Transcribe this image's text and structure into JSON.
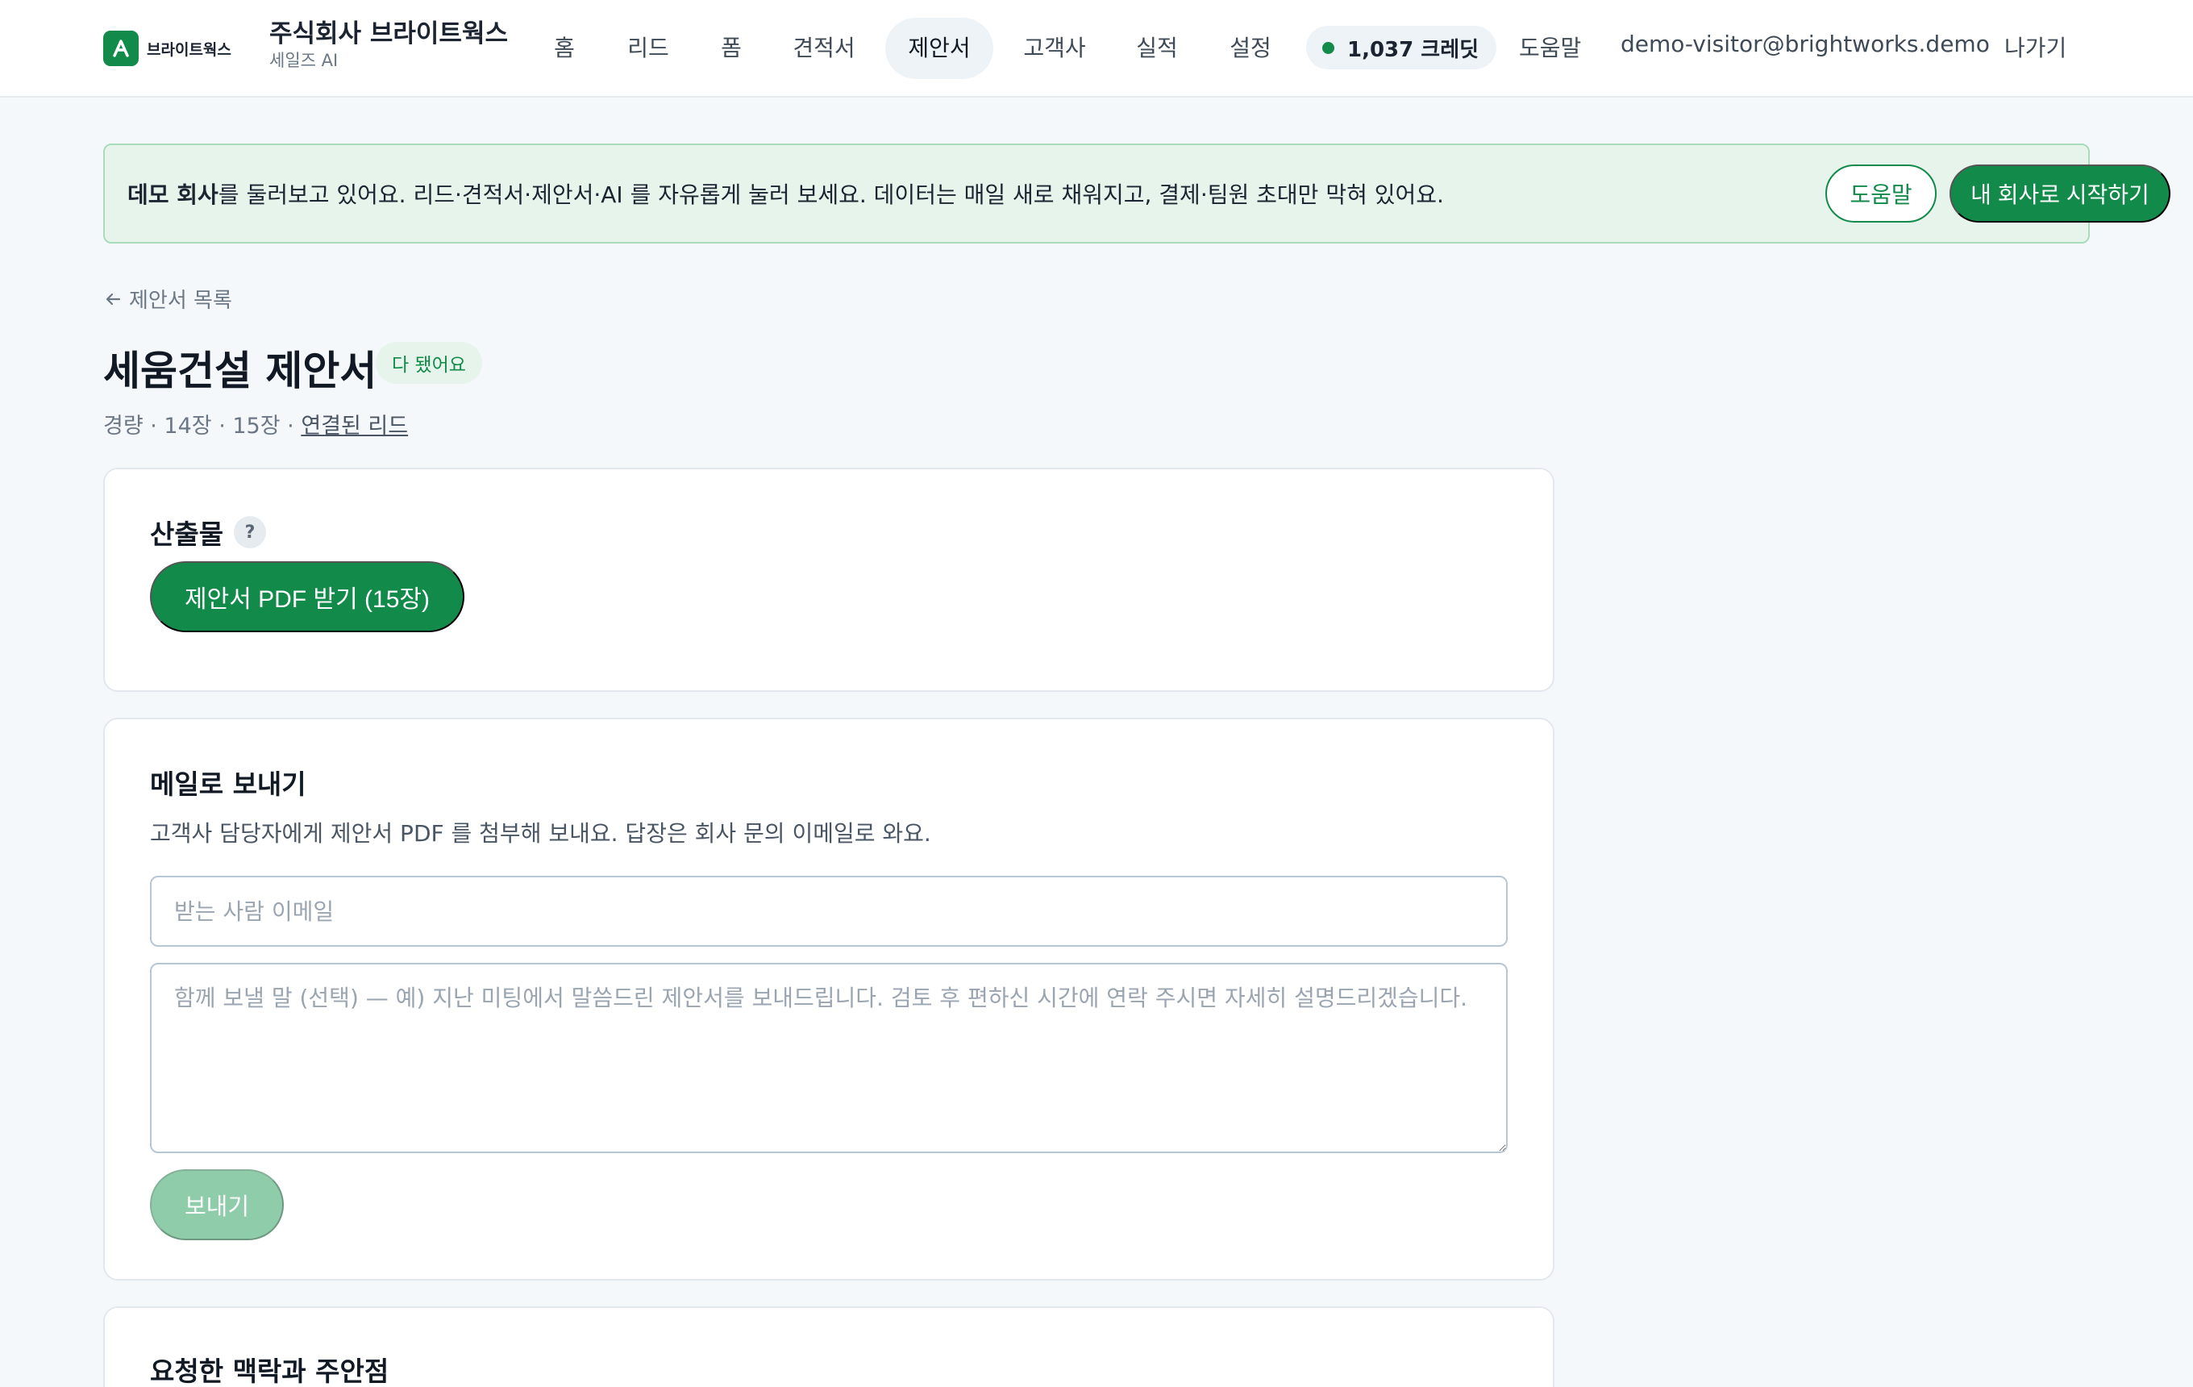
{
  "brand": {
    "logo_text": "브라이트웍스",
    "company_name": "주식회사 브라이트웍스",
    "company_sub": "세일즈 AI"
  },
  "nav": {
    "items": [
      {
        "label": "홈"
      },
      {
        "label": "리드"
      },
      {
        "label": "폼"
      },
      {
        "label": "견적서"
      },
      {
        "label": "제안서",
        "active": true
      },
      {
        "label": "고객사"
      },
      {
        "label": "실적"
      },
      {
        "label": "설정"
      }
    ],
    "credits": "1,037 크레딧",
    "help": "도움말",
    "user_email": "demo-visitor@brightworks.demo",
    "logout": "나가기"
  },
  "banner": {
    "bold": "데모 회사",
    "text": "를 둘러보고 있어요. 리드·견적서·제안서·AI 를 자유롭게 눌러 보세요. 데이터는 매일 새로 채워지고, 결제·팀원 초대만 막혀 있어요.",
    "help_button": "도움말",
    "start_button": "내 회사로 시작하기"
  },
  "header": {
    "back_link": "제안서 목록",
    "title": "세움건설 제안서",
    "status": "다 됐어요",
    "meta": "경량 · 14장 · 15장 · ",
    "meta_link": "연결된 리드"
  },
  "output_card": {
    "title": "산출물",
    "help": "?",
    "pdf_button": "제안서 PDF 받기 (15장)"
  },
  "email_card": {
    "title": "메일로 보내기",
    "description": "고객사 담당자에게 제안서 PDF 를 첨부해 보내요. 답장은 회사 문의 이메일로 와요.",
    "email_placeholder": "받는 사람 이메일",
    "message_placeholder": "함께 보낼 말 (선택) — 예) 지난 미팅에서 말씀드린 제안서를 보내드립니다. 검토 후 편하신 시간에 연락 주시면 자세히 설명드리겠습니다.",
    "send_button": "보내기"
  },
  "context_card": {
    "title": "요청한 맥락과 주안점"
  },
  "colors": {
    "accent": "#128a4a",
    "accent_disabled": "#8fccaa",
    "banner_bg": "#e7f4ec",
    "page_bg": "#f5f8fb"
  }
}
